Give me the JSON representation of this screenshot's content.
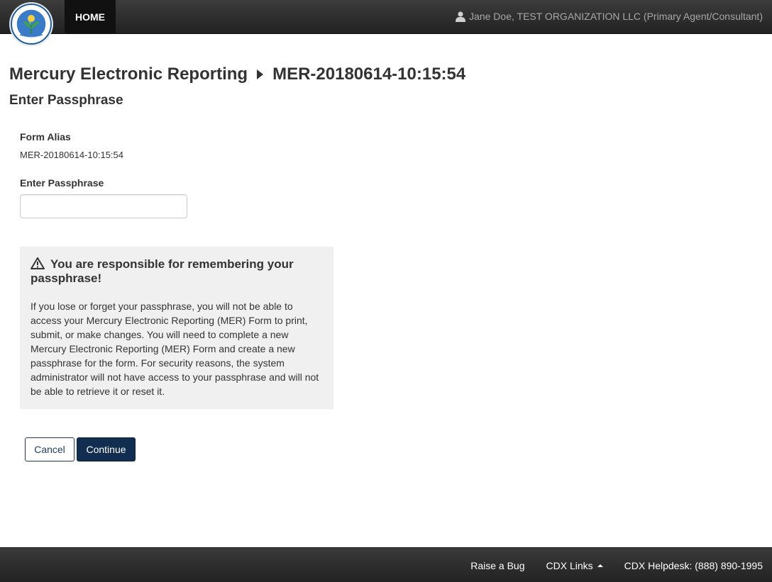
{
  "header": {
    "logo_name": "epa-seal-logo",
    "nav_home": "HOME",
    "user_text": "Jane Doe, TEST ORGANIZATION LLC (Primary Agent/Consultant)"
  },
  "page": {
    "title": "Mercury Electronic Reporting",
    "form_id": "MER-20180614-10:15:54",
    "subtitle": "Enter Passphrase"
  },
  "form": {
    "alias_label": "Form Alias",
    "alias_value": "MER-20180614-10:15:54",
    "passphrase_label": "Enter Passphrase",
    "passphrase_value": ""
  },
  "warning": {
    "heading": "You are responsible for remembering your passphrase!",
    "body": "If you lose or forget your passphrase, you will not be able to access your Mercury Electronic Reporting (MER) Form to print, submit, or make changes. You will need to complete a new Mercury Electronic Reporting (MER) Form and create a new passphrase for the form. For security reasons, the system administrator will not have access to your passphrase and will not be able to retrieve it or reset it."
  },
  "buttons": {
    "cancel": "Cancel",
    "continue": "Continue"
  },
  "footer": {
    "raise_bug": "Raise a Bug",
    "cdx_links": "CDX Links",
    "helpdesk": "CDX Helpdesk: (888) 890-1995"
  },
  "colors": {
    "navbar": "#2b2b2b",
    "primary_button": "#112e51",
    "warning_bg": "#f0f0f0"
  }
}
